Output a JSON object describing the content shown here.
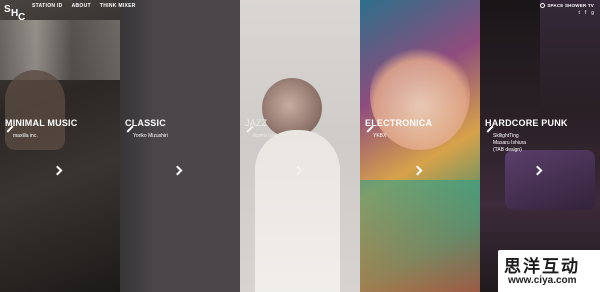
{
  "header": {
    "logo": {
      "part1": "S",
      "part2": "H",
      "part3": "C"
    },
    "nav": [
      {
        "label": "STATION ID"
      },
      {
        "label": "ABOUT"
      },
      {
        "label": "THINK MIXER"
      }
    ],
    "brand": "SPACE SHOWER TV",
    "social": {
      "twitter": "t",
      "facebook": "f",
      "google": "g"
    }
  },
  "panels": [
    {
      "genre": "MINIMAL MUSIC",
      "artists": [
        "maxilla inc."
      ]
    },
    {
      "genre": "CLASSIC",
      "artists": [
        "Yoriko Mizushiri"
      ]
    },
    {
      "genre": "JAZZ",
      "artists": [
        "Ikuma Ishii"
      ]
    },
    {
      "genre": "ELECTRONICA",
      "artists": [
        "YKBX"
      ]
    },
    {
      "genre": "HARDCORE PUNK",
      "artists": [
        "SkllightTing",
        "Masaru Ishiura",
        "(TAB design)"
      ]
    }
  ],
  "watermark": {
    "chinese": "思洋互动",
    "url": "www.ciya.com"
  }
}
